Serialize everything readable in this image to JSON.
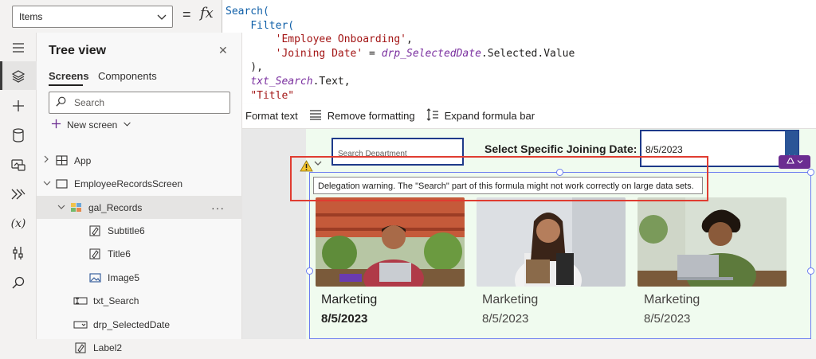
{
  "property_selector": {
    "value": "Items"
  },
  "formula_bar": {
    "equals": "=",
    "fx": "fx",
    "lines": [
      [
        {
          "t": "kw",
          "v": "Search("
        }
      ],
      [
        {
          "t": "plain",
          "v": "    "
        },
        {
          "t": "kw",
          "v": "Filter("
        }
      ],
      [
        {
          "t": "plain",
          "v": "        "
        },
        {
          "t": "str",
          "v": "'Employee Onboarding'"
        },
        {
          "t": "plain",
          "v": ","
        }
      ],
      [
        {
          "t": "plain",
          "v": "        "
        },
        {
          "t": "str",
          "v": "'Joining Date'"
        },
        {
          "t": "plain",
          "v": " = "
        },
        {
          "t": "var",
          "v": "drp_SelectedDate"
        },
        {
          "t": "plain",
          "v": ".Selected.Value"
        }
      ],
      [
        {
          "t": "plain",
          "v": "    ),"
        }
      ],
      [
        {
          "t": "plain",
          "v": "    "
        },
        {
          "t": "var",
          "v": "txt_Search"
        },
        {
          "t": "plain",
          "v": ".Text,"
        }
      ],
      [
        {
          "t": "plain",
          "v": "    "
        },
        {
          "t": "str",
          "v": "\"Title\""
        }
      ]
    ]
  },
  "formula_toolbar": {
    "format_text": "Format text",
    "remove_formatting": "Remove formatting",
    "expand_formula_bar": "Expand formula bar"
  },
  "tree_view": {
    "title": "Tree view",
    "tabs": [
      "Screens",
      "Components"
    ],
    "search_placeholder": "Search",
    "new_screen": "New screen",
    "nodes": [
      {
        "label": "App",
        "icon": "app-icon",
        "indent": 0,
        "chevron": "›"
      },
      {
        "label": "EmployeeRecordsScreen",
        "icon": "screen-icon",
        "indent": 0,
        "chevron": "⌄"
      },
      {
        "label": "gal_Records",
        "icon": "gallery-icon",
        "indent": 1,
        "chevron": "⌄",
        "selected": true
      },
      {
        "label": "Subtitle6",
        "icon": "label-icon",
        "indent": 2
      },
      {
        "label": "Title6",
        "icon": "label-icon",
        "indent": 2
      },
      {
        "label": "Image5",
        "icon": "image-icon",
        "indent": 2
      },
      {
        "label": "txt_Search",
        "icon": "textinput-icon",
        "indent": 1
      },
      {
        "label": "drp_SelectedDate",
        "icon": "dropdown-icon",
        "indent": 1
      },
      {
        "label": "Label2",
        "icon": "label-icon",
        "indent": 1
      }
    ]
  },
  "canvas": {
    "search_department_placeholder": "Search Department",
    "date_label": "Select Specific Joining Date:",
    "date_value": "8/5/2023",
    "delegation_warning": "Delegation warning. The \"Search\" part of this formula might not work correctly on large data sets.",
    "cards": [
      {
        "department": "Marketing",
        "date": "8/5/2023"
      },
      {
        "department": "Marketing",
        "date": "8/5/2023"
      },
      {
        "department": "Marketing",
        "date": "8/5/2023"
      }
    ]
  },
  "colors": {
    "accent_dark_blue": "#1e3a8a",
    "warning_red": "#e03c31",
    "screen_bg": "#f0fbef",
    "purple_chip": "#6b2c91"
  }
}
